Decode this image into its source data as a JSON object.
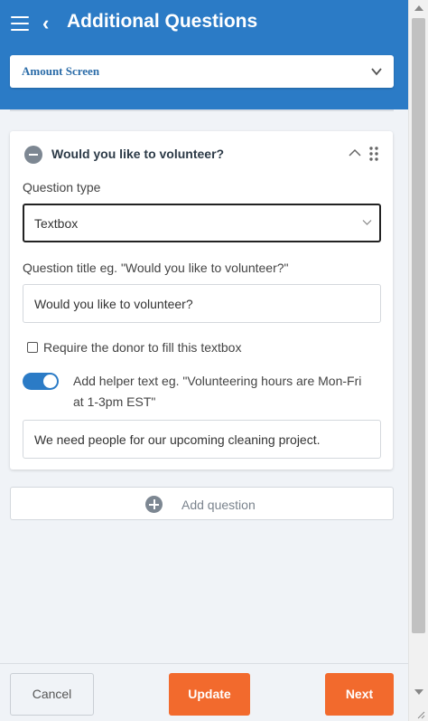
{
  "header": {
    "title": "Additional Questions",
    "menu_icon": "hamburger-menu-icon",
    "back_icon": "chevron-left-icon",
    "background_color": "#2b7bc6"
  },
  "screen_select": {
    "value": "Amount Screen",
    "icon": "chevron-down-icon"
  },
  "question_card": {
    "title": "Would you like to volunteer?",
    "collapse_icon": "minus-circle-icon",
    "caret_icon": "chevron-up-icon",
    "drag_icon": "drag-handle-icon",
    "question_type_label": "Question type",
    "question_type_value": "Textbox",
    "question_title_label": "Question title eg. \"Would you like to volunteer?\"",
    "question_title_value": "Would you like to volunteer?",
    "require_label": "Require the donor to fill this textbox",
    "require_checked": false,
    "helper_toggle_on": true,
    "helper_label_line1": "Add helper text eg. \"Volunteering hours are Mon-Fri",
    "helper_label_line2": "at 1-3pm EST\"",
    "helper_text_value": "We need people for our upcoming cleaning project."
  },
  "add_question": {
    "label": "Add question",
    "icon": "plus-circle-icon"
  },
  "footer": {
    "cancel_label": "Cancel",
    "update_label": "Update",
    "next_label": "Next",
    "accent_color": "#f26a2d"
  }
}
